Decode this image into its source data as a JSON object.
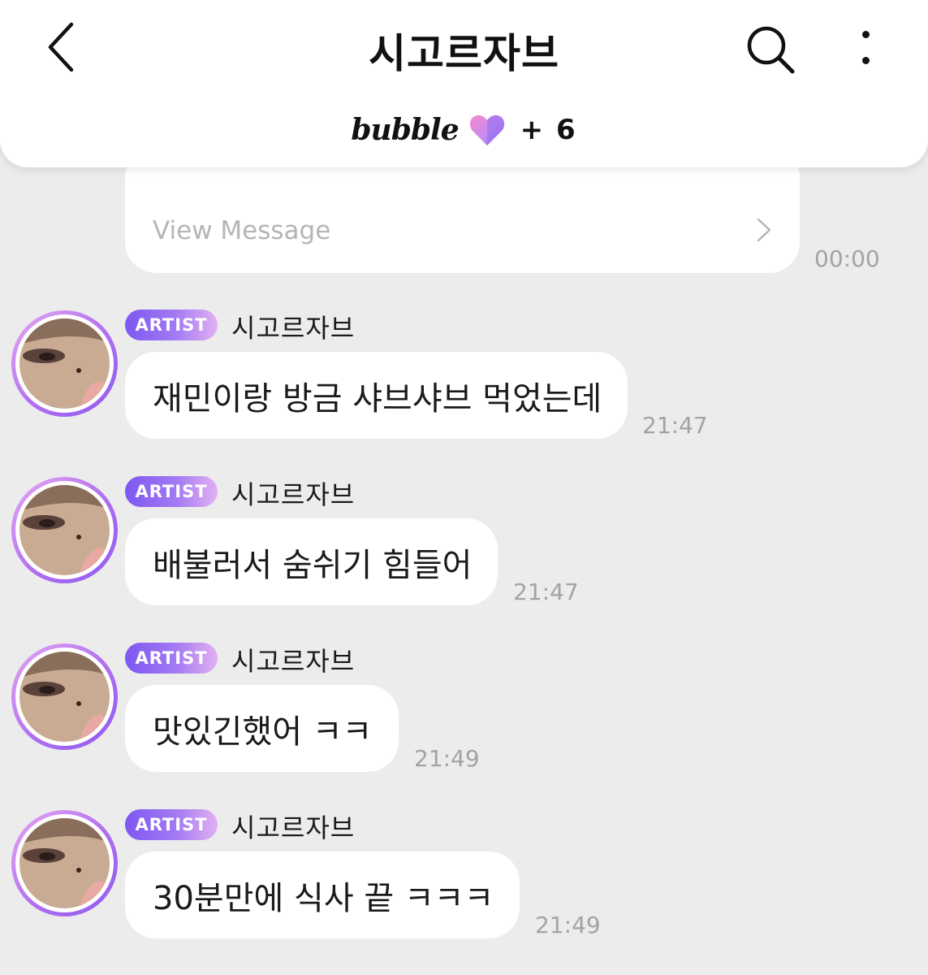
{
  "header": {
    "title": "시고르자브",
    "logo_text": "bubble",
    "member_count": "+ 6"
  },
  "previous_message": {
    "link_label": "View Message",
    "time": "00:00"
  },
  "messages": [
    {
      "badge": "ARTIST",
      "sender": "시고르자브",
      "text": "재민이랑 방금 샤브샤브 먹었는데",
      "time": "21:47"
    },
    {
      "badge": "ARTIST",
      "sender": "시고르자브",
      "text": "배불러서 숨쉬기 힘들어",
      "time": "21:47"
    },
    {
      "badge": "ARTIST",
      "sender": "시고르자브",
      "text": "맛있긴했어 ㅋㅋ",
      "time": "21:49"
    },
    {
      "badge": "ARTIST",
      "sender": "시고르자브",
      "text": "30분만에 식사 끝 ㅋㅋㅋ",
      "time": "21:49"
    }
  ],
  "colors": {
    "background": "#ececed",
    "bubble": "#ffffff",
    "badge_start": "#7d57f2",
    "badge_end": "#e3b0f2",
    "timestamp": "#a3a3a6"
  }
}
